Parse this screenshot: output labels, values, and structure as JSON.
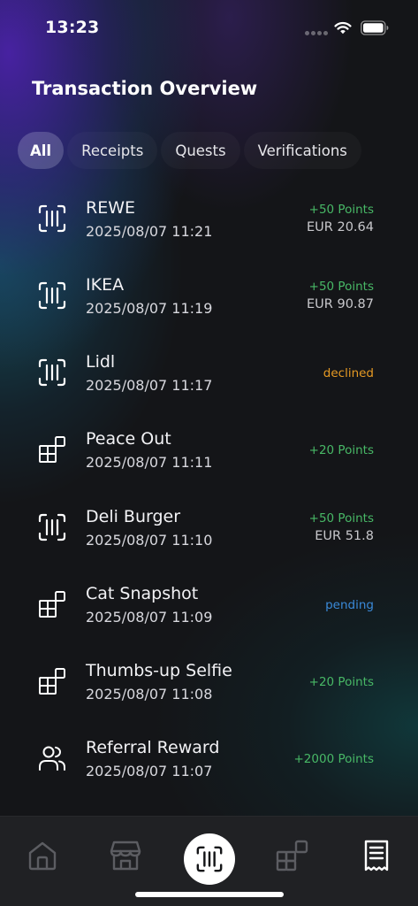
{
  "status_bar": {
    "time": "13:23",
    "icons": [
      "signal-dots-icon",
      "wifi-icon",
      "battery-icon"
    ]
  },
  "header": {
    "title": "Transaction Overview"
  },
  "tabs": [
    {
      "label": "All",
      "active": true
    },
    {
      "label": "Receipts",
      "active": false
    },
    {
      "label": "Quests",
      "active": false
    },
    {
      "label": "Verifications",
      "active": false
    }
  ],
  "transactions": [
    {
      "icon": "receipt-scan-icon",
      "name": "REWE",
      "date": "2025/08/07 11:21",
      "status": "+50 Points",
      "status_type": "points",
      "amount": "EUR 20.64"
    },
    {
      "icon": "receipt-scan-icon",
      "name": "IKEA",
      "date": "2025/08/07 11:19",
      "status": "+50 Points",
      "status_type": "points",
      "amount": "EUR 90.87"
    },
    {
      "icon": "receipt-scan-icon",
      "name": "Lidl",
      "date": "2025/08/07 11:17",
      "status": "declined",
      "status_type": "declined",
      "amount": ""
    },
    {
      "icon": "quest-blocks-icon",
      "name": "Peace Out",
      "date": "2025/08/07 11:11",
      "status": "+20 Points",
      "status_type": "points",
      "amount": ""
    },
    {
      "icon": "receipt-scan-icon",
      "name": "Deli Burger",
      "date": "2025/08/07 11:10",
      "status": "+50 Points",
      "status_type": "points",
      "amount": "EUR 51.8"
    },
    {
      "icon": "quest-blocks-icon",
      "name": "Cat Snapshot",
      "date": "2025/08/07 11:09",
      "status": "pending",
      "status_type": "pending",
      "amount": ""
    },
    {
      "icon": "quest-blocks-icon",
      "name": "Thumbs-up Selfie",
      "date": "2025/08/07 11:08",
      "status": "+20 Points",
      "status_type": "points",
      "amount": ""
    },
    {
      "icon": "users-icon",
      "name": "Referral Reward",
      "date": "2025/08/07 11:07",
      "status": "+2000 Points",
      "status_type": "points",
      "amount": ""
    }
  ],
  "colors": {
    "points": "#48b866",
    "declined": "#e69a23",
    "pending": "#3a8ad9",
    "nav_background": "#202124",
    "background": "#141518"
  },
  "bottom_nav": {
    "items": [
      {
        "icon": "home-icon",
        "active": false
      },
      {
        "icon": "store-icon",
        "active": false
      },
      {
        "icon": "scan-receipt-icon",
        "active": false,
        "primary": true
      },
      {
        "icon": "quests-icon",
        "active": false
      },
      {
        "icon": "transactions-receipt-icon",
        "active": true
      }
    ]
  }
}
